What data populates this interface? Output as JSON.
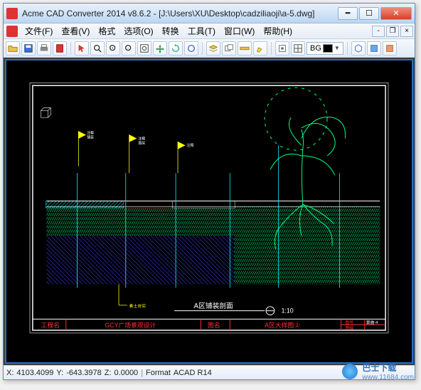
{
  "window": {
    "title": "Acme CAD Converter 2014 v8.6.2 - [J:\\Users\\XU\\Desktop\\cadziliaoji\\a-5.dwg]"
  },
  "menu": {
    "file": "文件(F)",
    "view": "查看(V)",
    "format": "格式",
    "options": "选项(O)",
    "convert": "转换",
    "tools": "工具(T)",
    "window": "窗口(W)",
    "help": "帮助(H)"
  },
  "toolbar": {
    "bg_label": "BG"
  },
  "drawing": {
    "frame_label_left": "工程名",
    "project_name": "GCY广场景观设计",
    "frame_label_mid": "图名",
    "drawing_name": "A区大样图②",
    "frame_label_right1": "图号",
    "drawing_no": "景施-4",
    "frame_label_right2": "图幅",
    "section_label": "A区铺装剖面",
    "scale_label": "1:10"
  },
  "status": {
    "x_label": "X:",
    "x_value": "4103.4099",
    "y_label": "Y:",
    "y_value": "-643.3978",
    "z_label": "Z:",
    "z_value": "0.0000",
    "format_label": "Format",
    "format_value": "ACAD R14"
  },
  "watermark": {
    "text": "巴士下载",
    "url": "www.11684.com"
  },
  "colors": {
    "accent": "#2a6fbf",
    "cad_green": "#00ff80",
    "cad_cyan": "#00ffff",
    "cad_yellow": "#ffff00",
    "cad_red": "#ff3030",
    "cad_blue": "#4040ff",
    "cad_white": "#ffffff"
  }
}
